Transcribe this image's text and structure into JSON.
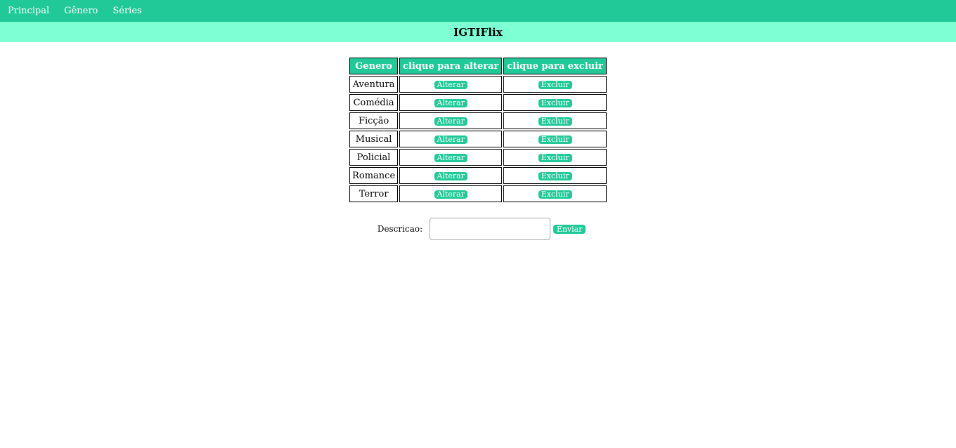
{
  "nav": {
    "items": [
      {
        "label": "Principal"
      },
      {
        "label": "Gênero"
      },
      {
        "label": "Séries"
      }
    ]
  },
  "header": {
    "title": "IGTIFlix"
  },
  "table": {
    "headers": [
      "Genero",
      "clique para alterar",
      "clique para excluir"
    ],
    "rows": [
      {
        "genero": "Aventura",
        "alterar": "Alterar",
        "excluir": "Excluir"
      },
      {
        "genero": "Comédia",
        "alterar": "Alterar",
        "excluir": "Excluir"
      },
      {
        "genero": "Ficção",
        "alterar": "Alterar",
        "excluir": "Excluir"
      },
      {
        "genero": "Musical",
        "alterar": "Alterar",
        "excluir": "Excluir"
      },
      {
        "genero": "Policial",
        "alterar": "Alterar",
        "excluir": "Excluir"
      },
      {
        "genero": "Romance",
        "alterar": "Alterar",
        "excluir": "Excluir"
      },
      {
        "genero": "Terror",
        "alterar": "Alterar",
        "excluir": "Excluir"
      }
    ]
  },
  "form": {
    "label": "Descricao:",
    "input_value": "",
    "submit_label": "Enviar"
  },
  "colors": {
    "nav_bg": "#20c997",
    "title_bg": "#7fffd4",
    "accent": "#20c997"
  }
}
